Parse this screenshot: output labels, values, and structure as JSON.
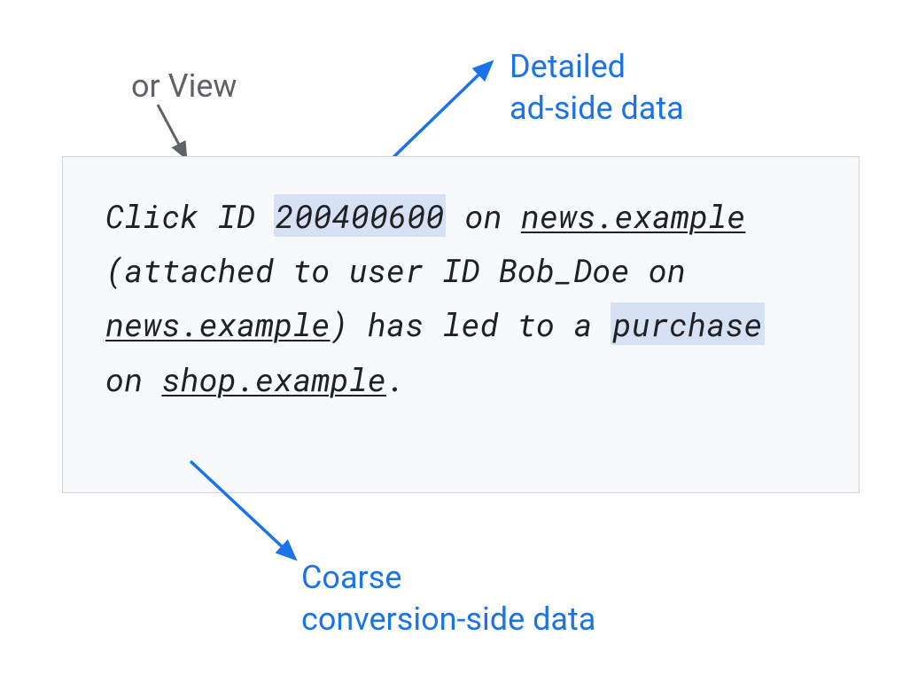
{
  "annotations": {
    "top_gray": "or View",
    "top_blue_line1": "Detailed",
    "top_blue_line2": "ad-side data",
    "bottom_blue_line1": "Coarse",
    "bottom_blue_line2": "conversion-side data"
  },
  "main_text": {
    "part1": "Click ID ",
    "click_id": "200400600",
    "part2": " on ",
    "news_example_1": "news.example",
    "part3": " (attached to user ID Bob_Doe on ",
    "news_example_2": "news.example",
    "part4": ") has led to a ",
    "purchase": "purchase",
    "part5": " on ",
    "shop_example": "shop.example",
    "period": "."
  }
}
